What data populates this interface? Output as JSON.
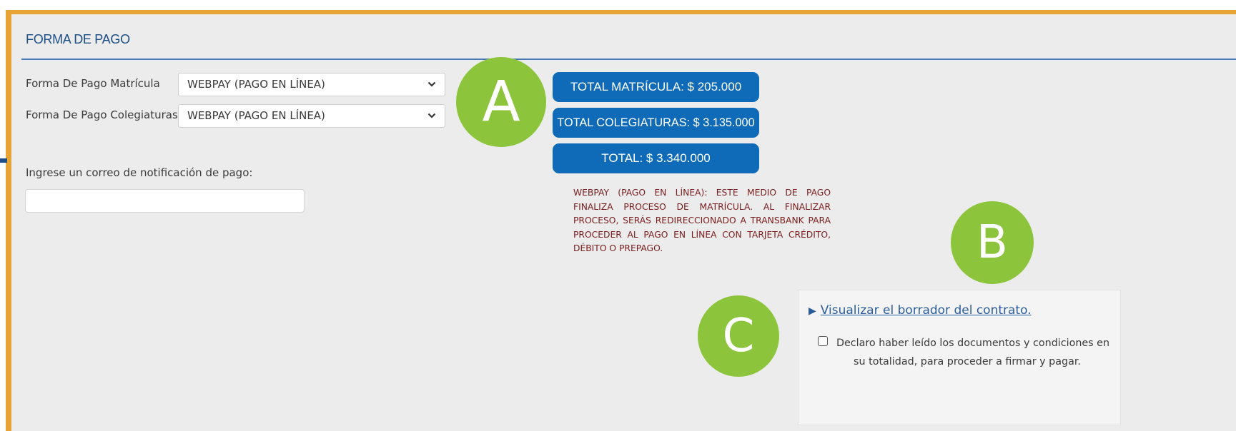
{
  "section": {
    "title": "FORMA DE PAGO"
  },
  "payment": {
    "matricula_label": "Forma De Pago Matrícula",
    "matricula_value": "WEBPAY (PAGO EN LÍNEA)",
    "colegiaturas_label": "Forma De Pago Colegiaturas",
    "colegiaturas_value": "WEBPAY (PAGO EN LÍNEA)"
  },
  "email": {
    "label": "Ingrese un correo de notificación de pago:",
    "value": ""
  },
  "totals": {
    "matricula": "TOTAL MATRÍCULA: $ 205.000",
    "colegiaturas": "TOTAL COLEGIATURAS: $ 3.135.000",
    "total": "TOTAL: $ 3.340.000"
  },
  "notice": "WEBPAY (PAGO EN LÍNEA): ESTE MEDIO DE PAGO FINALIZA PROCESO DE MATRÍCULA. AL FINALIZAR PROCESO, SERÁS REDIRECCIONADO A TRANSBANK PARA PROCEDER AL PAGO EN LÍNEA CON TARJETA CRÉDITO, DÉBITO O PREPAGO.",
  "contract": {
    "link_text": "Visualizar el borrador del contrato.",
    "declare_text": "Declaro haber leído los documentos y condiciones en su totalidad, para proceder a firmar y pagar.",
    "checkbox_checked": false
  },
  "annotations": {
    "a": "A",
    "b": "B",
    "c": "C"
  },
  "colors": {
    "frame": "#e8a335",
    "accent_blue": "#0f6bb7",
    "marker_green": "#8cc43c",
    "notice_red": "#7a1c1c"
  },
  "icons": {
    "select_arrow": "chevron-down-icon",
    "link_marker": "triangle-right-icon"
  }
}
